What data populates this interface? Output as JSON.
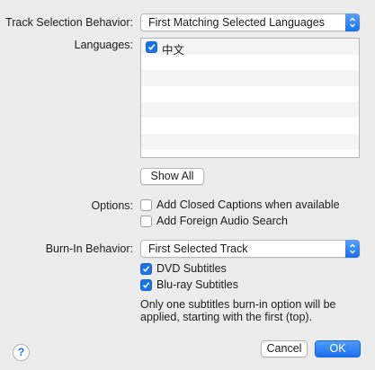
{
  "track_selection": {
    "label": "Track Selection Behavior:",
    "value": "First Matching Selected Languages"
  },
  "languages": {
    "label": "Languages:",
    "items": [
      {
        "name": "中文",
        "checked": true
      }
    ]
  },
  "show_all_label": "Show All",
  "options": {
    "label": "Options:",
    "closed_captions": {
      "label": "Add Closed Captions when available",
      "checked": false
    },
    "foreign_audio": {
      "label": "Add Foreign Audio Search",
      "checked": false
    }
  },
  "burn_in": {
    "label": "Burn-In Behavior:",
    "value": "First Selected Track",
    "dvd": {
      "label": "DVD Subtitles",
      "checked": true
    },
    "bluray": {
      "label": "Blu-ray Subtitles",
      "checked": true
    },
    "note_line1": "Only one subtitles burn-in option will be",
    "note_line2": "applied, starting with the first (top)."
  },
  "buttons": {
    "help": "?",
    "cancel": "Cancel",
    "ok": "OK"
  },
  "colors": {
    "accent": "#1a73e8",
    "window_bg": "#ececec"
  }
}
